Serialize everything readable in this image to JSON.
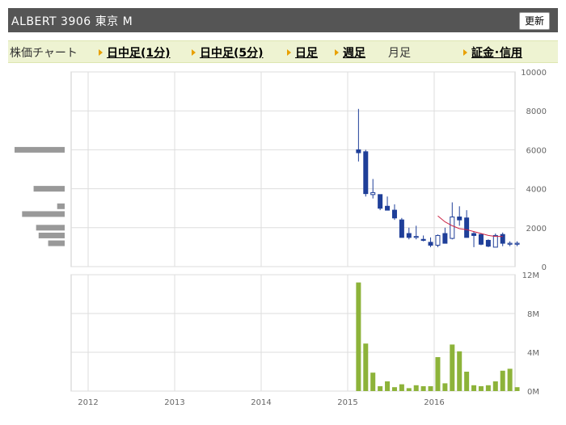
{
  "header": {
    "title": "ALBERT  3906  東京 M",
    "refresh_label": "更新"
  },
  "tabs": [
    {
      "label": "株価チャート",
      "link": false
    },
    {
      "label": "日中足(1分)",
      "link": true
    },
    {
      "label": "日中足(5分)",
      "link": true
    },
    {
      "label": "日足",
      "link": true
    },
    {
      "label": "週足",
      "link": true
    },
    {
      "label": "月足",
      "link": false
    },
    {
      "label": "証金･信用",
      "link": true
    }
  ],
  "colors": {
    "down": "#1f3f99",
    "up_border": "#1f3f99",
    "ma": "#cc2244",
    "volume": "#8db33a",
    "profile": "#999999",
    "grid": "#dddddd"
  },
  "chart_data": [
    {
      "type": "candlestick",
      "x_tick_labels": [
        "2012",
        "2013",
        "2014",
        "2015",
        "2016"
      ],
      "y_tick_labels": [
        "10000",
        "8000",
        "6000",
        "4000",
        "2000",
        "0"
      ],
      "ylim": [
        0,
        10000
      ],
      "months": [
        "2015-02",
        "2015-03",
        "2015-04",
        "2015-05",
        "2015-06",
        "2015-07",
        "2015-08",
        "2015-09",
        "2015-10",
        "2015-11",
        "2015-12",
        "2016-01",
        "2016-02",
        "2016-03",
        "2016-04",
        "2016-05",
        "2016-06",
        "2016-07",
        "2016-08",
        "2016-09",
        "2016-10",
        "2016-11",
        "2016-12"
      ],
      "ohlc": [
        [
          6000,
          8100,
          5400,
          5850
        ],
        [
          5900,
          6000,
          3600,
          3750
        ],
        [
          3700,
          4500,
          3500,
          3800
        ],
        [
          3700,
          3700,
          2900,
          3000
        ],
        [
          3100,
          3600,
          2900,
          2900
        ],
        [
          2900,
          3200,
          2400,
          2500
        ],
        [
          2400,
          2500,
          1500,
          1500
        ],
        [
          1700,
          2000,
          1400,
          1500
        ],
        [
          1500,
          2100,
          1400,
          1550
        ],
        [
          1400,
          1600,
          1300,
          1350
        ],
        [
          1250,
          1500,
          1000,
          1100
        ],
        [
          1100,
          1650,
          1000,
          1600
        ],
        [
          1700,
          2000,
          1300,
          1200
        ],
        [
          1450,
          3300,
          1400,
          2550
        ],
        [
          2550,
          3100,
          2100,
          2400
        ],
        [
          2500,
          2900,
          1600,
          1500
        ],
        [
          1700,
          1800,
          1000,
          1600
        ],
        [
          1650,
          1700,
          1100,
          1150
        ],
        [
          1350,
          1400,
          1000,
          1050
        ],
        [
          1000,
          1700,
          1000,
          1600
        ],
        [
          1650,
          1750,
          1050,
          1200
        ],
        [
          1150,
          1300,
          1050,
          1200
        ],
        [
          1150,
          1300,
          1050,
          1200
        ]
      ],
      "moving_average": [
        null,
        null,
        null,
        null,
        null,
        null,
        null,
        null,
        null,
        null,
        null,
        2600,
        2300,
        2100,
        1950,
        1900,
        1800,
        1700,
        1600,
        1550,
        1550,
        null,
        null
      ],
      "price_profile": [
        {
          "price": 6000,
          "value": 1.0
        },
        {
          "price": 4000,
          "value": 0.62
        },
        {
          "price": 3100,
          "value": 0.15
        },
        {
          "price": 2700,
          "value": 0.85
        },
        {
          "price": 2000,
          "value": 0.57
        },
        {
          "price": 1600,
          "value": 0.52
        },
        {
          "price": 1200,
          "value": 0.33
        }
      ]
    },
    {
      "type": "bar",
      "y_tick_labels": [
        "12M",
        "8M",
        "4M",
        "0M"
      ],
      "ylim": [
        0,
        12
      ],
      "months": [
        "2015-02",
        "2015-03",
        "2015-04",
        "2015-05",
        "2015-06",
        "2015-07",
        "2015-08",
        "2015-09",
        "2015-10",
        "2015-11",
        "2015-12",
        "2016-01",
        "2016-02",
        "2016-03",
        "2016-04",
        "2016-05",
        "2016-06",
        "2016-07",
        "2016-08",
        "2016-09",
        "2016-10",
        "2016-11",
        "2016-12"
      ],
      "values": [
        11.2,
        4.9,
        1.9,
        0.5,
        1.0,
        0.4,
        0.7,
        0.3,
        0.6,
        0.5,
        0.5,
        3.5,
        0.8,
        4.8,
        4.1,
        2.0,
        0.6,
        0.5,
        0.6,
        1.0,
        2.1,
        2.3,
        0.4
      ]
    }
  ]
}
